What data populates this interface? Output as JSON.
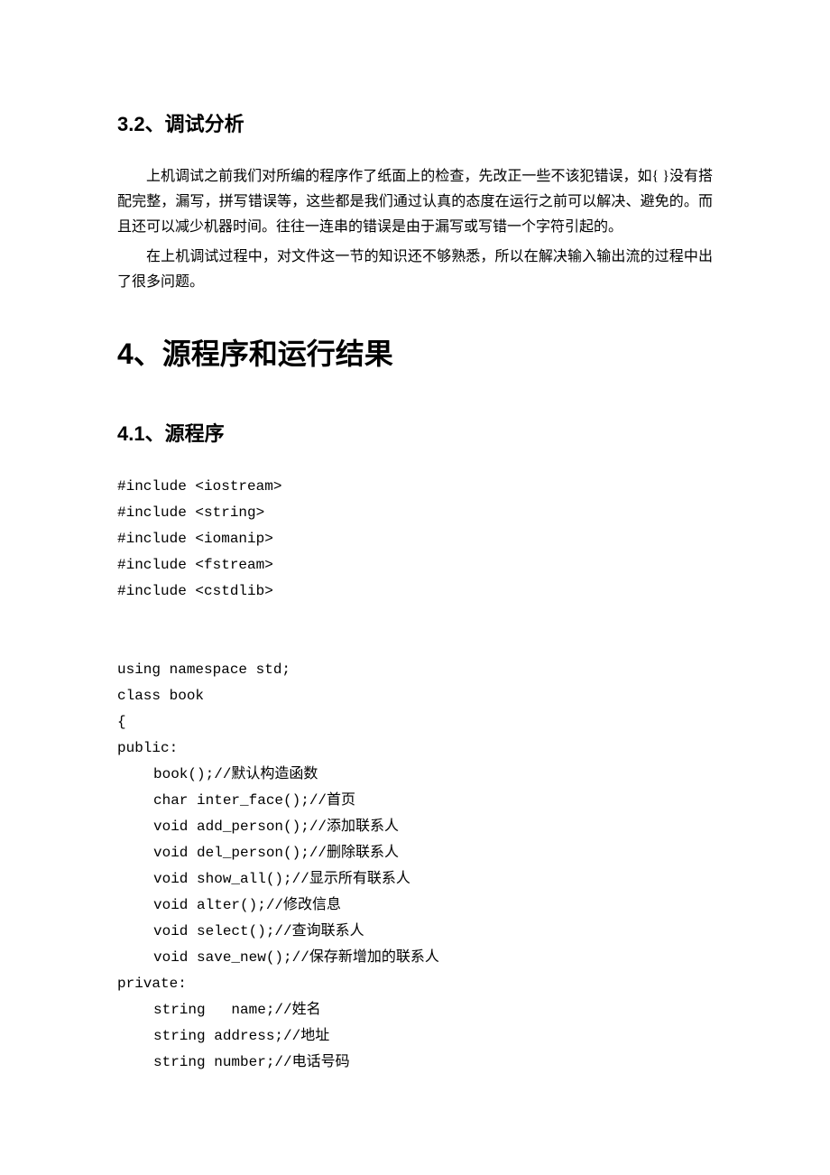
{
  "sections": {
    "s32": {
      "heading": "3.2、调试分析",
      "p1": "上机调试之前我们对所编的程序作了纸面上的检查，先改正一些不该犯错误，如{ }没有搭配完整，漏写，拼写错误等，这些都是我们通过认真的态度在运行之前可以解决、避免的。而且还可以减少机器时间。往往一连串的错误是由于漏写或写错一个字符引起的。",
      "p2": "在上机调试过程中，对文件这一节的知识还不够熟悉，所以在解决输入输出流的过程中出了很多问题。"
    },
    "s4": {
      "heading": "4、源程序和运行结果"
    },
    "s41": {
      "heading": "4.1、源程序",
      "code": [
        {
          "text": "#include <iostream>",
          "indent": false
        },
        {
          "text": "#include <string>",
          "indent": false
        },
        {
          "text": "#include <iomanip>",
          "indent": false
        },
        {
          "text": "#include <fstream>",
          "indent": false
        },
        {
          "text": "#include <cstdlib>",
          "indent": false
        },
        {
          "text": " ",
          "indent": false
        },
        {
          "text": " ",
          "indent": false
        },
        {
          "text": "using namespace std;",
          "indent": false
        },
        {
          "text": "class book",
          "indent": false
        },
        {
          "text": "{",
          "indent": false
        },
        {
          "text": "public:",
          "indent": false
        },
        {
          "text": "book();//默认构造函数",
          "indent": true
        },
        {
          "text": "char inter_face();//首页",
          "indent": true
        },
        {
          "text": "void add_person();//添加联系人",
          "indent": true
        },
        {
          "text": "void del_person();//删除联系人",
          "indent": true
        },
        {
          "text": "void show_all();//显示所有联系人",
          "indent": true
        },
        {
          "text": "void alter();//修改信息",
          "indent": true
        },
        {
          "text": "void select();//查询联系人",
          "indent": true
        },
        {
          "text": "void save_new();//保存新增加的联系人",
          "indent": true
        },
        {
          "text": "private:",
          "indent": false
        },
        {
          "text": "string   name;//姓名",
          "indent": true
        },
        {
          "text": "string address;//地址",
          "indent": true
        },
        {
          "text": "string number;//电话号码",
          "indent": true
        }
      ]
    }
  }
}
